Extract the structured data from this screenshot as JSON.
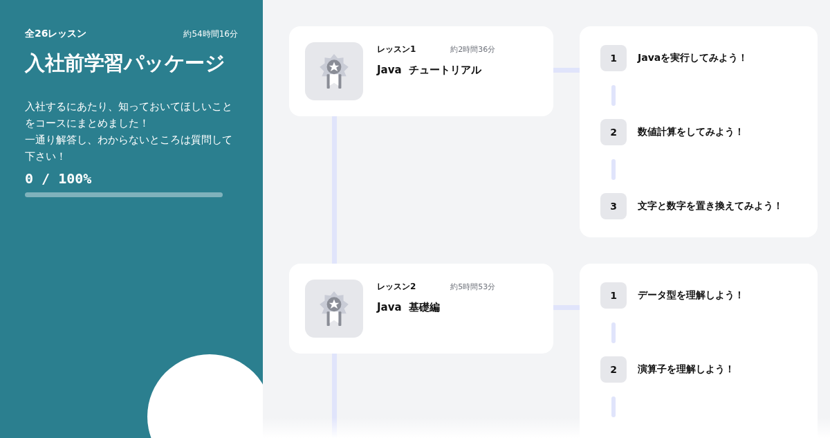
{
  "course": {
    "lesson_count": "全26レッスン",
    "duration": "約54時間16分",
    "title": "入社前学習パッケージ",
    "description": [
      "入社するにあたり、知っておいてほしいことをコースにまとめました！",
      "一通り解答し、わからないところは質問して下さい！"
    ],
    "progress": "0 / 100%",
    "level": 0
  },
  "lessons": [
    {
      "label": "レッスン1",
      "duration": "約2時間36分",
      "title": "Java  チュートリアル",
      "steps": [
        {
          "number": "1",
          "title": "Javaを実行してみよう！"
        },
        {
          "number": "2",
          "title": "数値計算をしてみよう！"
        },
        {
          "number": "3",
          "title": "文字と数字を置き換えてみよう！"
        }
      ]
    },
    {
      "label": "レッスン2",
      "duration": "約5時間53分",
      "title": "Java  基礎編",
      "steps": [
        {
          "number": "1",
          "title": "データ型を理解しよう！"
        },
        {
          "number": "2",
          "title": "演算子を理解しよう！"
        }
      ]
    }
  ]
}
